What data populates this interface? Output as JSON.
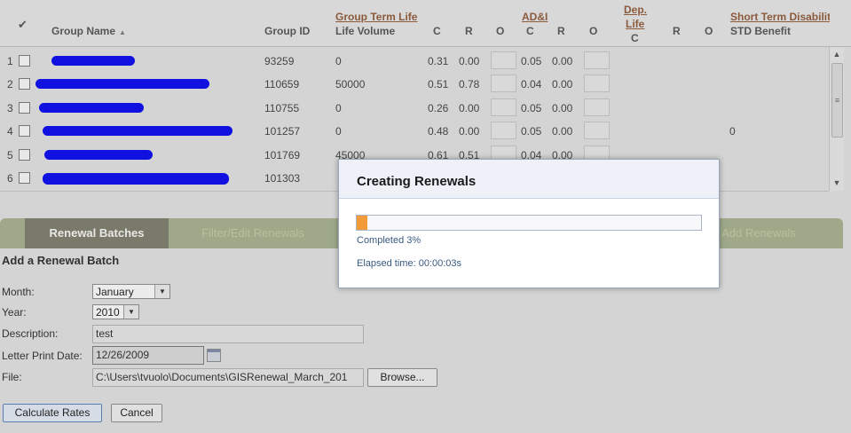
{
  "grid": {
    "header": {
      "select_all_glyph": "✔",
      "group_name": "Group Name",
      "sort_glyph": "▲",
      "group_id": "Group ID",
      "gtl_group": "Group Term Life",
      "gtl_volume": "Life Volume",
      "col_c": "C",
      "col_r": "R",
      "col_o": "O",
      "adnd_group": "AD&I",
      "dep_life_line1": "Dep.",
      "dep_life_line2": "Life",
      "std_group": "Short Term Disabilit",
      "std_benefit": "STD Benefit"
    },
    "rows": [
      {
        "num": "1",
        "group_id": "93259",
        "volume": "0",
        "c": "0.31",
        "r": "0.00",
        "ad_c": "0.05",
        "ad_r": "0.00",
        "std": ""
      },
      {
        "num": "2",
        "group_id": "110659",
        "volume": "50000",
        "c": "0.51",
        "r": "0.78",
        "ad_c": "0.04",
        "ad_r": "0.00",
        "std": ""
      },
      {
        "num": "3",
        "group_id": "110755",
        "volume": "0",
        "c": "0.26",
        "r": "0.00",
        "ad_c": "0.05",
        "ad_r": "0.00",
        "std": ""
      },
      {
        "num": "4",
        "group_id": "101257",
        "volume": "0",
        "c": "0.48",
        "r": "0.00",
        "ad_c": "0.05",
        "ad_r": "0.00",
        "std": "0"
      },
      {
        "num": "5",
        "group_id": "101769",
        "volume": "45000",
        "c": "0.61",
        "r": "0.51",
        "ad_c": "0.04",
        "ad_r": "0.00",
        "std": ""
      },
      {
        "num": "6",
        "group_id": "101303",
        "volume": "",
        "c": "",
        "r": "",
        "ad_c": "",
        "ad_r": "",
        "std": ""
      }
    ]
  },
  "tabs": {
    "renewal_batches": "Renewal Batches",
    "filter_edit": "Filter/Edit Renewals",
    "add_renewals": "Add Renewals"
  },
  "form": {
    "title": "Add a Renewal Batch",
    "month_label": "Month:",
    "month_value": "January",
    "year_label": "Year:",
    "year_value": "2010",
    "description_label": "Description:",
    "description_value": "test",
    "letter_date_label": "Letter Print Date:",
    "letter_date_value": "12/26/2009",
    "file_label": "File:",
    "file_value": "C:\\Users\\tvuolo\\Documents\\GISRenewal_March_201",
    "browse_label": "Browse...",
    "calculate_label": "Calculate Rates",
    "cancel_label": "Cancel"
  },
  "dialog": {
    "title": "Creating Renewals",
    "progress_percent": 3,
    "completed_text": "Completed 3%",
    "elapsed_text": "Elapsed time: 00:00:03s"
  },
  "colors": {
    "redaction": "#1010e0",
    "progress": "#f39a3a",
    "header_link": "#8b5a3c"
  }
}
